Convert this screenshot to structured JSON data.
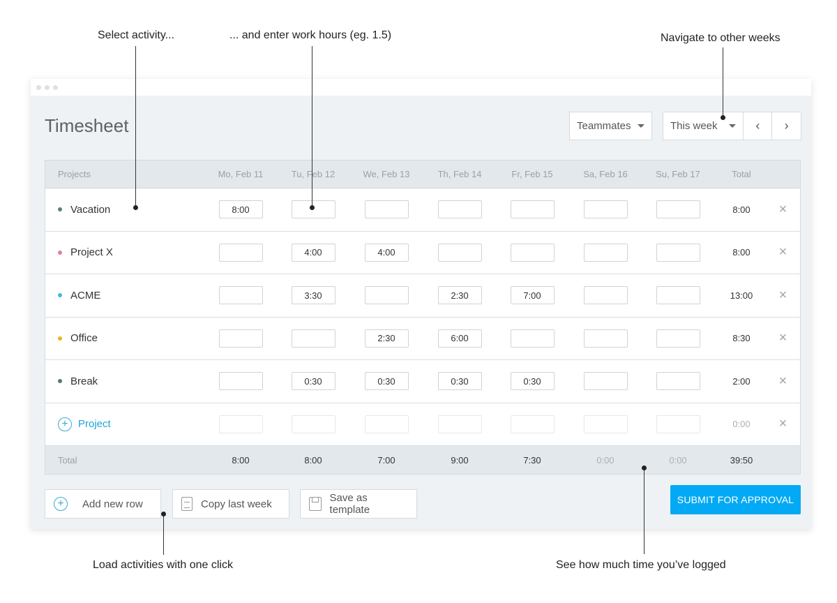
{
  "annotations": {
    "select_activity": "Select activity...",
    "enter_hours": "... and enter work hours (eg. 1.5)",
    "navigate_weeks": "Navigate to other weeks",
    "load_activities": "Load activities with one click",
    "time_logged": "See how much time you’ve logged"
  },
  "header": {
    "title": "Timesheet",
    "teammates_label": "Teammates",
    "week_label": "This week",
    "prev_icon": "‹",
    "next_icon": "›"
  },
  "table": {
    "columns": [
      "Projects",
      "Mo, Feb 11",
      "Tu, Feb 12",
      "We, Feb 13",
      "Th, Feb 14",
      "Fr, Feb 15",
      "Sa, Feb 16",
      "Su, Feb 17",
      "Total"
    ],
    "rows": [
      {
        "project": "Vacation",
        "color": "#5f7f7f",
        "hours": [
          "8:00",
          "",
          "",
          "",
          "",
          "",
          ""
        ],
        "total": "8:00"
      },
      {
        "project": "Project X",
        "color": "#e27fa3",
        "hours": [
          "",
          "4:00",
          "4:00",
          "",
          "",
          "",
          ""
        ],
        "total": "8:00"
      },
      {
        "project": "ACME",
        "color": "#3fb7e2",
        "hours": [
          "",
          "3:30",
          "",
          "2:30",
          "7:00",
          "",
          ""
        ],
        "total": "13:00"
      },
      {
        "project": "Office",
        "color": "#f3b119",
        "hours": [
          "",
          "",
          "2:30",
          "6:00",
          "",
          "",
          ""
        ],
        "total": "8:30"
      },
      {
        "project": "Break",
        "color": "#5f7379",
        "hours": [
          "",
          "0:30",
          "0:30",
          "0:30",
          "0:30",
          "",
          ""
        ],
        "total": "2:00"
      }
    ],
    "add_row": {
      "label": "Project",
      "total": "0:00"
    },
    "footer": {
      "label": "Total",
      "values": [
        "8:00",
        "8:00",
        "7:00",
        "9:00",
        "7:30",
        "0:00",
        "0:00"
      ],
      "total": "39:50"
    },
    "delete_icon": "×"
  },
  "actions": {
    "add_new_row": "Add new row",
    "copy_last_week": "Copy last week",
    "save_as_template": "Save as template",
    "submit": "SUBMIT FOR APPROVAL"
  },
  "colors": {
    "accent": "#03a9f4"
  }
}
